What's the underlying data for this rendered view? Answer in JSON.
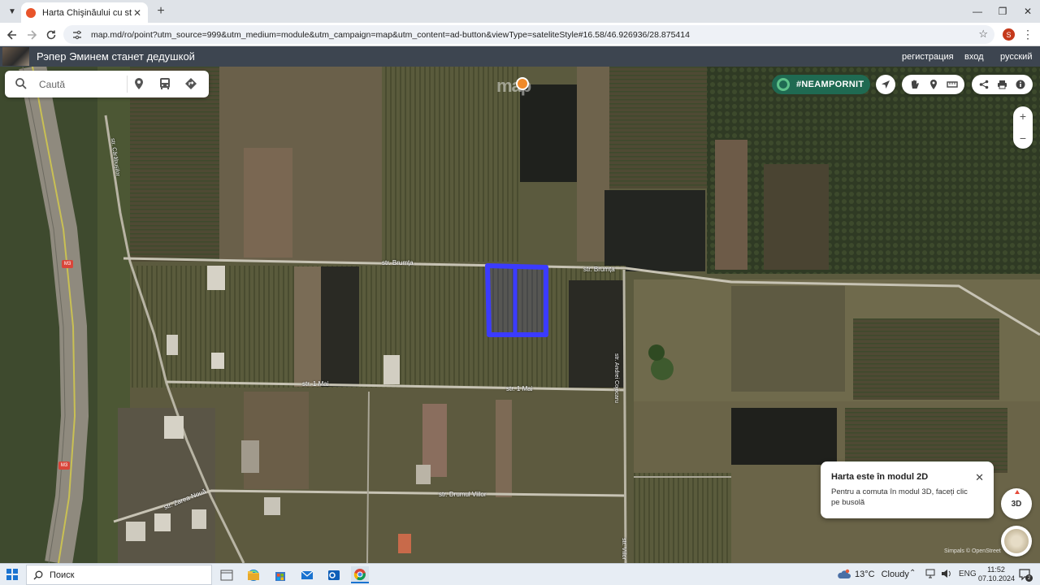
{
  "browser": {
    "tab_title": "Harta Chişinăului cu străzi şi rut",
    "tab_close": "✕",
    "new_tab": "+",
    "url": "map.md/ro/point?utm_source=999&utm_medium=module&utm_campaign=map&utm_content=ad-button&viewType=sateliteStyle#16.58/46.926936/28.875414",
    "profile_initial": "S",
    "window": {
      "minimize": "—",
      "restore": "❐",
      "close": "✕"
    }
  },
  "header": {
    "news_title": "Рэпер Эминем станет дедушкой",
    "links": [
      "регистрация",
      "вход",
      "русский"
    ]
  },
  "search": {
    "placeholder": "Caută"
  },
  "logo_text": "map",
  "neam_label": "#NEAMPORNIT",
  "zoom": {
    "in": "+",
    "out": "−"
  },
  "map_labels": {
    "streets": [
      "str. Brumța",
      "str. Brumța",
      "str. 1 Mai",
      "str. 1 Mai",
      "str. Drumul Viilor",
      "str. Zarea Nouă",
      "str. Andrei Cojocaru",
      "str. Cărăbușilor",
      "str. Viilor"
    ],
    "road_shields": [
      "M3",
      "M3"
    ]
  },
  "tooltip": {
    "title": "Harta este în modul 2D",
    "body": "Pentru a comuta în modul 3D, faceți clic pe busolă",
    "close": "✕"
  },
  "mode_button": "3D",
  "attribution": "Simpals © OpenStreet",
  "taskbar": {
    "search_text": "Поиск",
    "weather_temp": "13°C",
    "weather_text": "Cloudy",
    "language": "ENG",
    "time": "11:52",
    "date": "07.10.2024",
    "notifications": "2"
  },
  "colors": {
    "header_bg": "#3d4550",
    "neam_bg": "#1f6a52",
    "polygon": "#3b3bff",
    "accent_orange": "#f08a2a"
  }
}
